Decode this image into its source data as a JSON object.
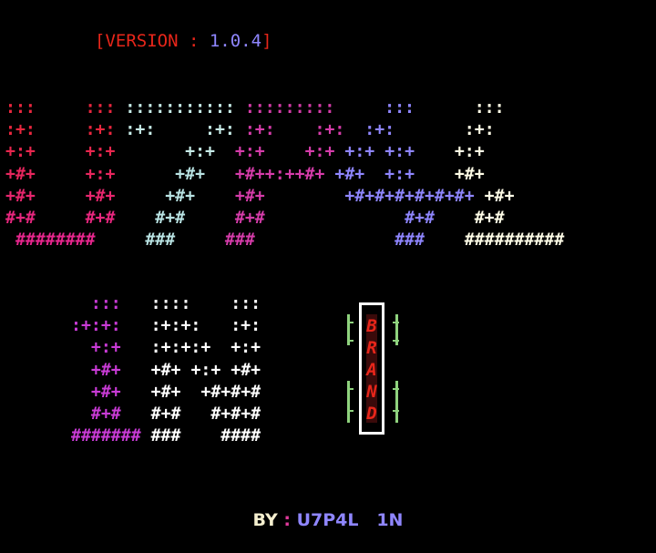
{
  "version": {
    "open": "[",
    "label": "VERSION",
    "separator": " : ",
    "number": "1.0.4",
    "close": "]",
    "label_color": "#e8261a",
    "number_color": "#8f86ff"
  },
  "brand": {
    "letters": [
      "B",
      "R",
      "A",
      "N",
      "D"
    ],
    "color": "#e8261a",
    "frame_color": "#ffffff",
    "bracket_color": "#8fd37e"
  },
  "byline": {
    "by": "BY",
    "separator": " : ",
    "author": "U7P4L",
    "suffix": "1N",
    "by_color": "#f5efcf",
    "separator_color": "#e03a9b",
    "author_color": "#8f86ff"
  },
  "art_top": {
    "rows": [
      [
        {
          "t": ":::",
          "c": "#e8263e"
        },
        {
          "t": "     "
        },
        {
          "t": ":::",
          "c": "#e8263e"
        },
        {
          "t": " "
        },
        {
          "t": ":::::::::::",
          "c": "#c7ece8"
        },
        {
          "t": " "
        },
        {
          "t": ":::::::::",
          "c": "#d63caa"
        },
        {
          "t": "     "
        },
        {
          "t": ":::",
          "c": "#8f86ff"
        },
        {
          "t": "      "
        },
        {
          "t": ":::",
          "c": "#fffde7"
        }
      ],
      [
        {
          "t": ":+:",
          "c": "#e8263e"
        },
        {
          "t": "     "
        },
        {
          "t": ":+:",
          "c": "#e8263e"
        },
        {
          "t": " "
        },
        {
          "t": ":+:",
          "c": "#c7ece8"
        },
        {
          "t": "     "
        },
        {
          "t": ":+:",
          "c": "#c7ece8"
        },
        {
          "t": " "
        },
        {
          "t": ":+:",
          "c": "#d63caa"
        },
        {
          "t": "    "
        },
        {
          "t": ":+:",
          "c": "#d63caa"
        },
        {
          "t": "  "
        },
        {
          "t": ":+:",
          "c": "#8f86ff"
        },
        {
          "t": "       "
        },
        {
          "t": ":+:",
          "c": "#fffde7"
        }
      ],
      [
        {
          "t": "+:+",
          "c": "#e8264e"
        },
        {
          "t": "     "
        },
        {
          "t": "+:+",
          "c": "#e8264e"
        },
        {
          "t": "       "
        },
        {
          "t": "+:+",
          "c": "#c7ece8"
        },
        {
          "t": "  "
        },
        {
          "t": "+:+",
          "c": "#d63caa"
        },
        {
          "t": "    "
        },
        {
          "t": "+:+",
          "c": "#d63caa"
        },
        {
          "t": " "
        },
        {
          "t": "+:+",
          "c": "#8f86ff"
        },
        {
          "t": " "
        },
        {
          "t": "+:+",
          "c": "#8f86ff"
        },
        {
          "t": "    "
        },
        {
          "t": "+:+",
          "c": "#fffde7"
        }
      ],
      [
        {
          "t": "+#+",
          "c": "#e8265e"
        },
        {
          "t": "     "
        },
        {
          "t": "+:+",
          "c": "#e8265e"
        },
        {
          "t": "      "
        },
        {
          "t": "+#+",
          "c": "#b9e3e3"
        },
        {
          "t": "   "
        },
        {
          "t": "+#++:++#+",
          "c": "#d63caa"
        },
        {
          "t": " "
        },
        {
          "t": "+#+",
          "c": "#8f86ff"
        },
        {
          "t": "  "
        },
        {
          "t": "+:+",
          "c": "#8f86ff"
        },
        {
          "t": "    "
        },
        {
          "t": "+#+",
          "c": "#fffde7"
        }
      ],
      [
        {
          "t": "+#+",
          "c": "#e8266e"
        },
        {
          "t": "     "
        },
        {
          "t": "+#+",
          "c": "#e8266e"
        },
        {
          "t": "     "
        },
        {
          "t": "+#+",
          "c": "#b9e3e3"
        },
        {
          "t": "    "
        },
        {
          "t": "+#+",
          "c": "#d63caa"
        },
        {
          "t": "        "
        },
        {
          "t": "+#+#+#+#+#+#+",
          "c": "#8f86ff"
        },
        {
          "t": " "
        },
        {
          "t": "+#+",
          "c": "#fffde7"
        }
      ],
      [
        {
          "t": "#+#",
          "c": "#e8267e"
        },
        {
          "t": "     "
        },
        {
          "t": "#+#",
          "c": "#e8267e"
        },
        {
          "t": "    "
        },
        {
          "t": "#+#",
          "c": "#b9e3e3"
        },
        {
          "t": "     "
        },
        {
          "t": "#+#",
          "c": "#d63caa"
        },
        {
          "t": "              "
        },
        {
          "t": "#+#",
          "c": "#8f86ff"
        },
        {
          "t": "    "
        },
        {
          "t": "#+#",
          "c": "#fffde7"
        }
      ],
      [
        {
          "t": " "
        },
        {
          "t": "########",
          "c": "#e8268e"
        },
        {
          "t": "     "
        },
        {
          "t": "###",
          "c": "#b9e3e3"
        },
        {
          "t": "     "
        },
        {
          "t": "###",
          "c": "#d63caa"
        },
        {
          "t": "              "
        },
        {
          "t": "###",
          "c": "#8f86ff"
        },
        {
          "t": "    "
        },
        {
          "t": "##########",
          "c": "#fffde7"
        }
      ]
    ]
  },
  "art_bottom": {
    "rows": [
      [
        {
          "t": "  "
        },
        {
          "t": ":::",
          "c": "#c93bd6"
        },
        {
          "t": "   "
        },
        {
          "t": "::::",
          "c": "#ffffff"
        },
        {
          "t": "    "
        },
        {
          "t": ":::",
          "c": "#ffffff"
        }
      ],
      [
        {
          "t": ":+:+:",
          "c": "#c93bd6"
        },
        {
          "t": "   "
        },
        {
          "t": ":+:+:",
          "c": "#ffffff"
        },
        {
          "t": "   "
        },
        {
          "t": ":+:",
          "c": "#ffffff"
        }
      ],
      [
        {
          "t": "  "
        },
        {
          "t": "+:+",
          "c": "#c93bd6"
        },
        {
          "t": "   "
        },
        {
          "t": ":+:+:+",
          "c": "#ffffff"
        },
        {
          "t": "  "
        },
        {
          "t": "+:+",
          "c": "#ffffff"
        }
      ],
      [
        {
          "t": "  "
        },
        {
          "t": "+#+",
          "c": "#c93bd6"
        },
        {
          "t": "   "
        },
        {
          "t": "+#+",
          "c": "#ffffff"
        },
        {
          "t": " "
        },
        {
          "t": "+:+",
          "c": "#ffffff"
        },
        {
          "t": " "
        },
        {
          "t": "+#+",
          "c": "#ffffff"
        }
      ],
      [
        {
          "t": "  "
        },
        {
          "t": "+#+",
          "c": "#c93bd6"
        },
        {
          "t": "   "
        },
        {
          "t": "+#+",
          "c": "#ffffff"
        },
        {
          "t": "  "
        },
        {
          "t": "+#+#+#",
          "c": "#ffffff"
        }
      ],
      [
        {
          "t": "  "
        },
        {
          "t": "#+#",
          "c": "#c93bd6"
        },
        {
          "t": "   "
        },
        {
          "t": "#+#",
          "c": "#ffffff"
        },
        {
          "t": "   "
        },
        {
          "t": "#+#+#",
          "c": "#ffffff"
        }
      ],
      [
        {
          "t": "#######",
          "c": "#c93bd6"
        },
        {
          "t": " "
        },
        {
          "t": "###",
          "c": "#ffffff"
        },
        {
          "t": "    "
        },
        {
          "t": "####",
          "c": "#ffffff"
        }
      ]
    ]
  }
}
